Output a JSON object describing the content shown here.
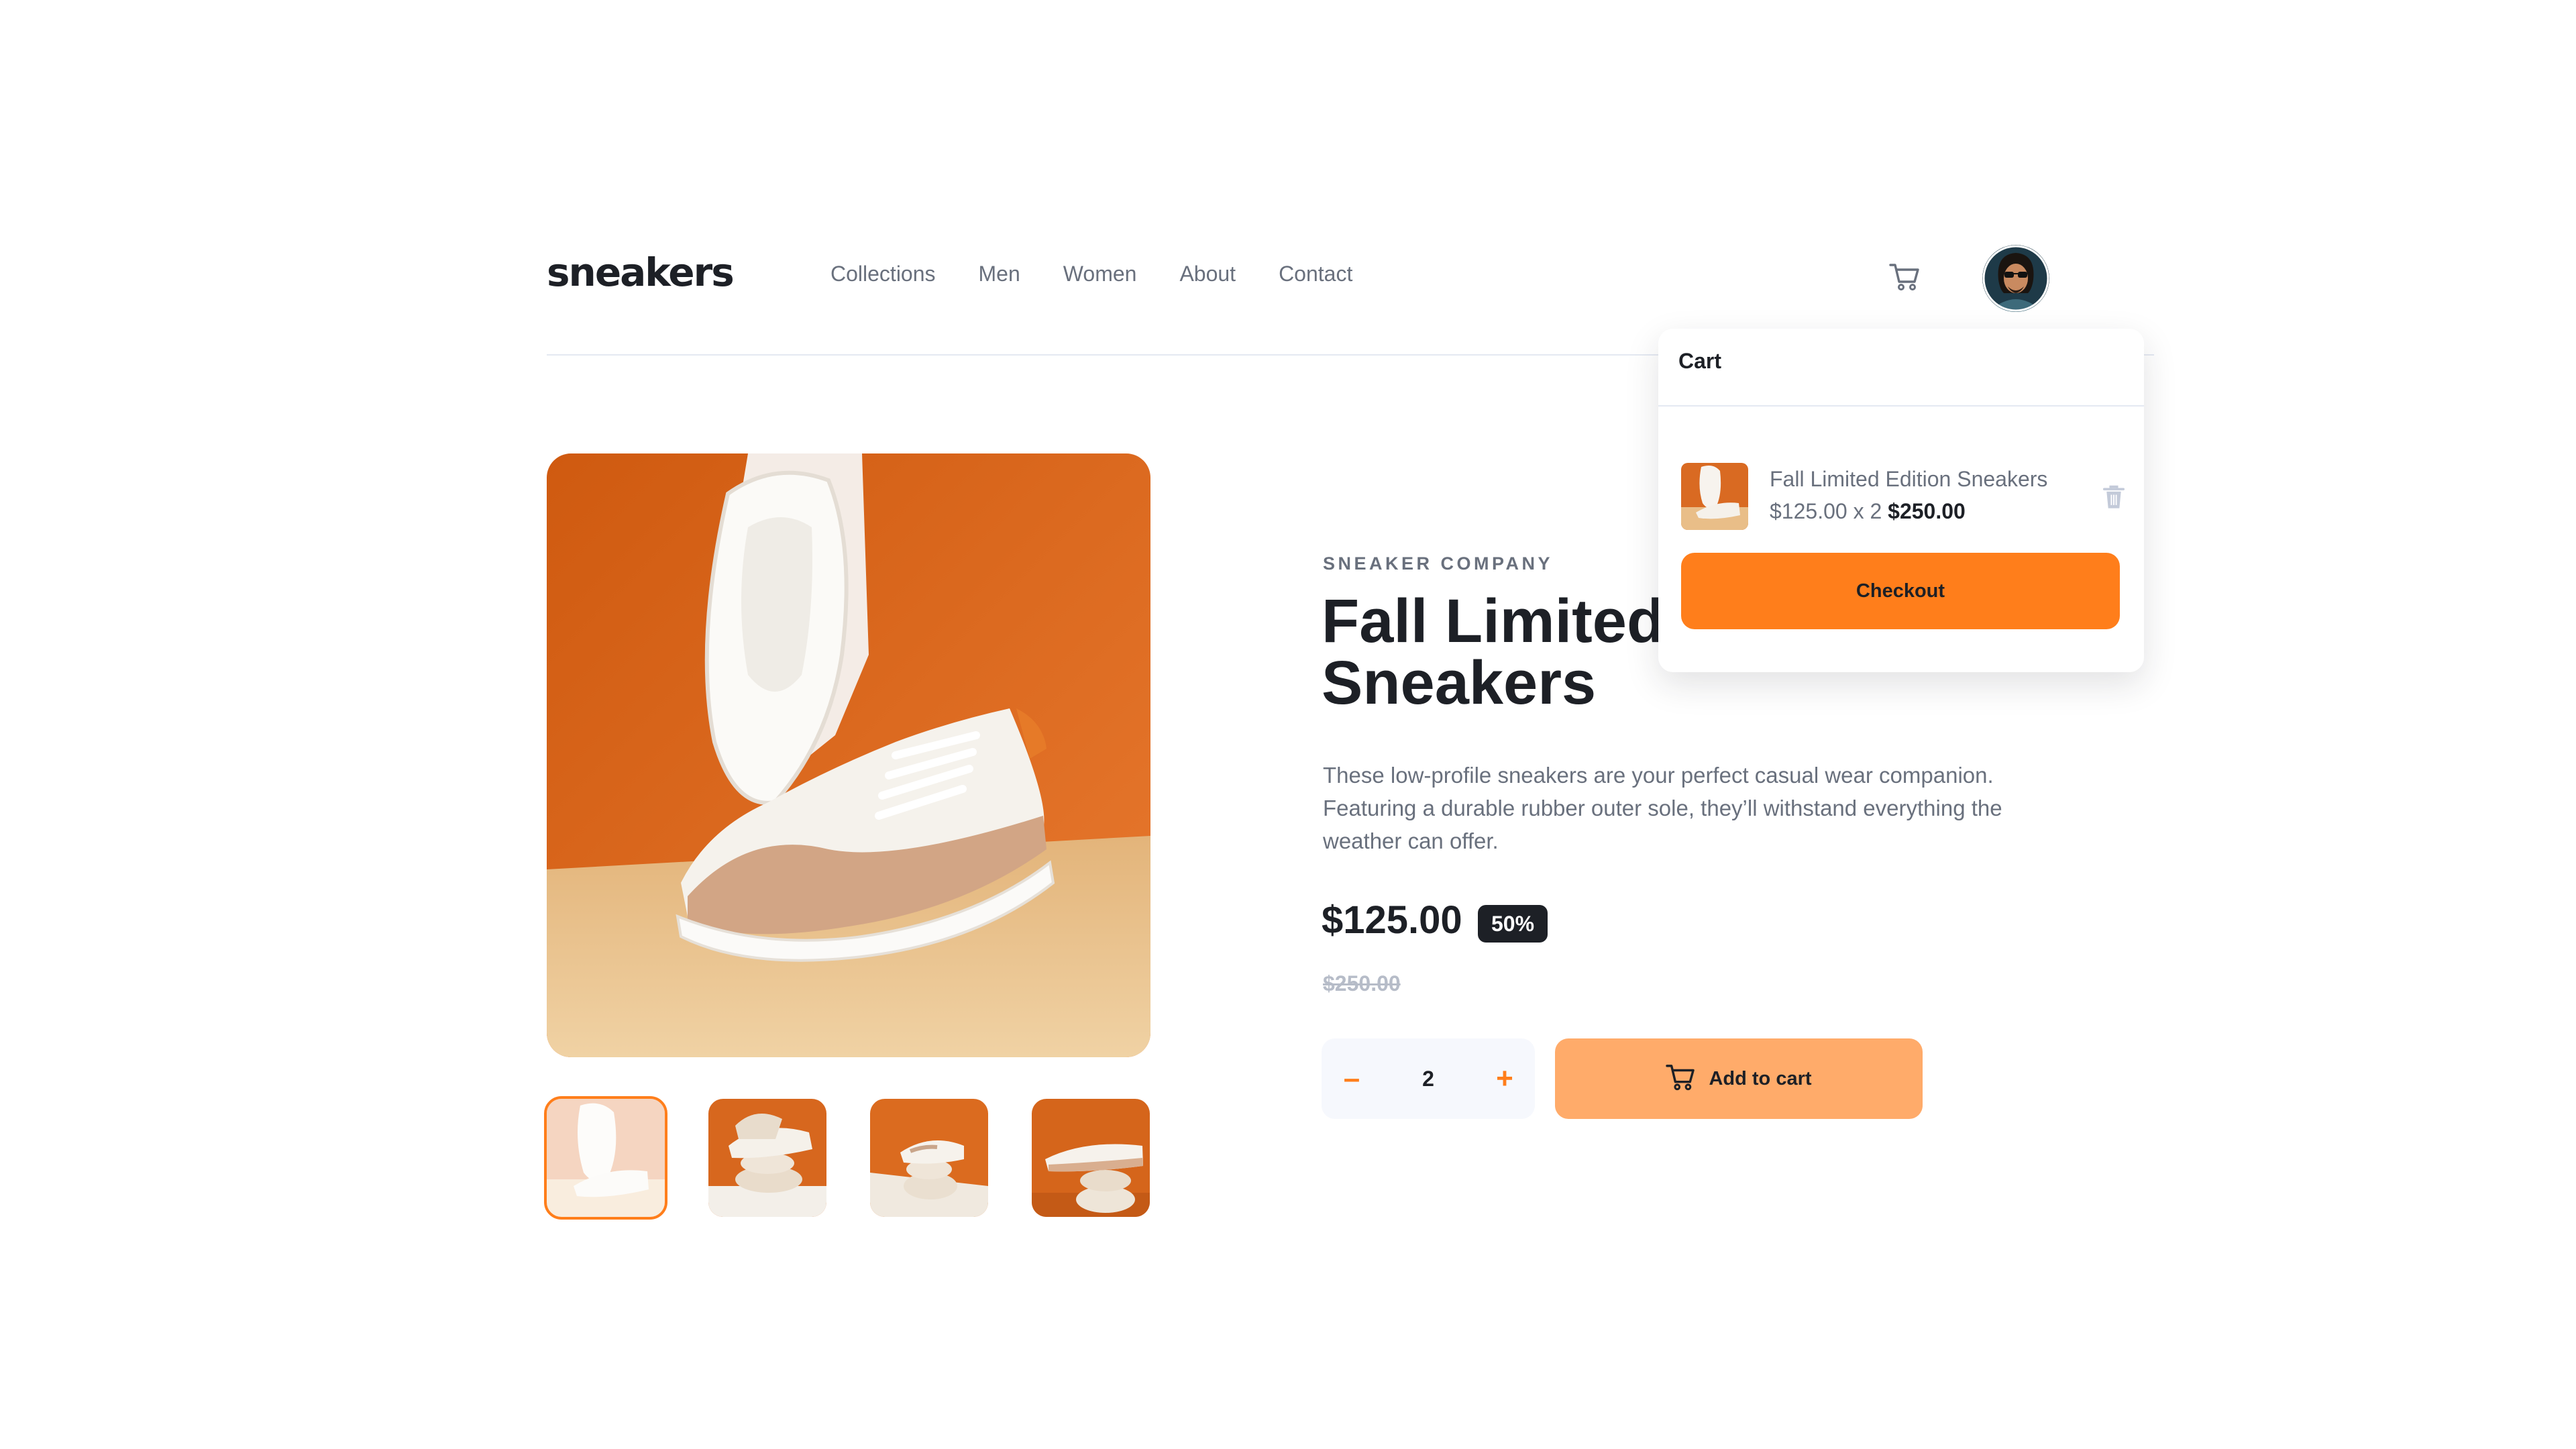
{
  "header": {
    "logo": "sneakers",
    "nav": [
      "Collections",
      "Men",
      "Women",
      "About",
      "Contact"
    ],
    "cart_icon": "cart-icon",
    "avatar_icon": "user-avatar"
  },
  "gallery": {
    "thumbnail_count": 4,
    "active_thumbnail": 1
  },
  "product": {
    "company": "SNEAKER COMPANY",
    "title": "Fall Limited Edition Sneakers",
    "title_visible": "Fall Limited",
    "title_line2": "Sneakers",
    "description": "These low-profile sneakers are your perfect casual wear companion. Featuring a durable rubber outer sole, they’ll withstand everything the weather can offer.",
    "price": "$125.00",
    "discount": "50%",
    "old_price": "$250.00",
    "quantity": "2",
    "minus_label": "–",
    "plus_label": "+",
    "add_to_cart": "Add to cart"
  },
  "cart": {
    "title": "Cart",
    "item_name": "Fall Limited Edition Sneakers",
    "item_calc": "$125.00 x 2",
    "item_total": "$250.00",
    "delete_icon": "trash-icon",
    "checkout": "Checkout"
  },
  "colors": {
    "accent": "#ff7e1b",
    "accent_light": "#ffab6a",
    "dark": "#1d2026",
    "grey": "#69707d"
  }
}
